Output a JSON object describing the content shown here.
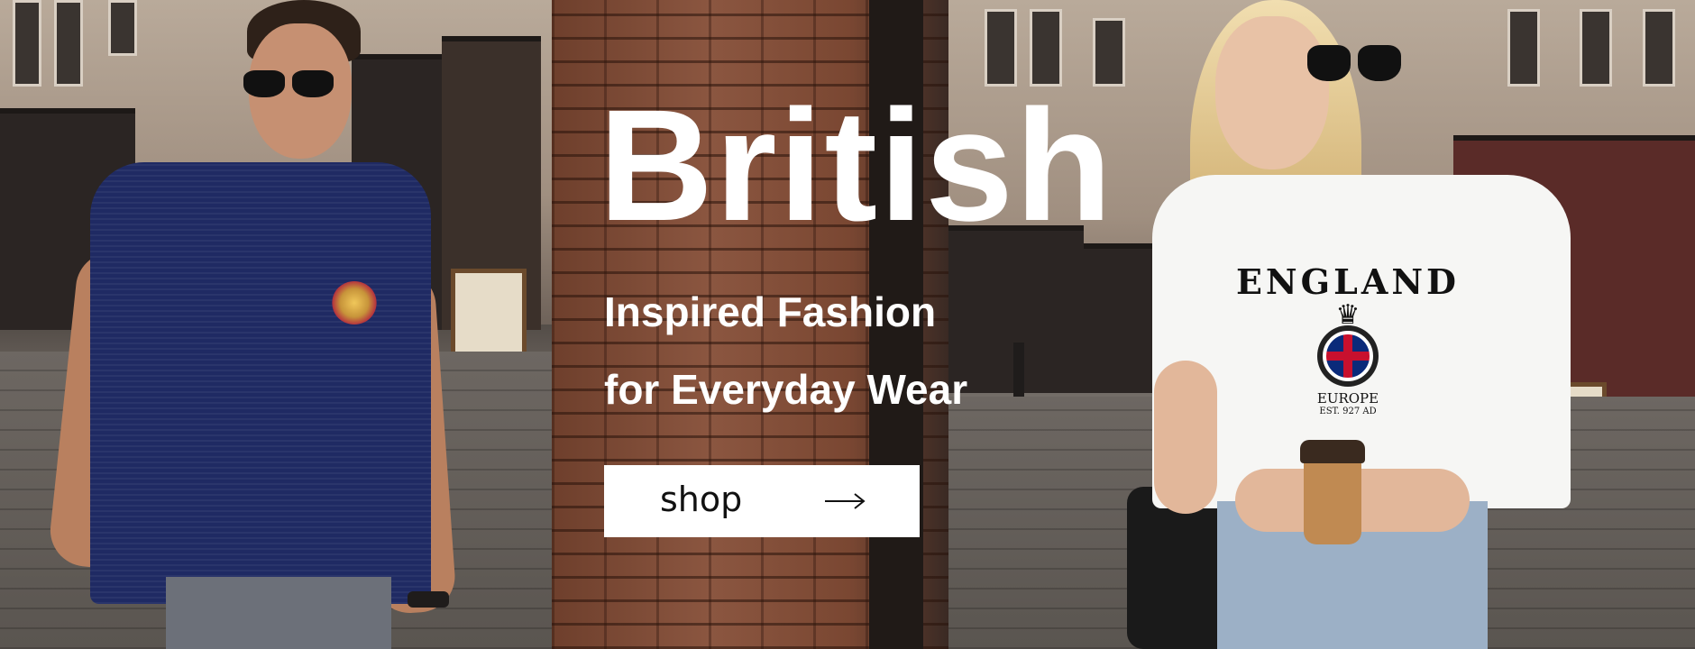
{
  "banner": {
    "headline": "British",
    "subline_1": "Inspired Fashion",
    "subline_2": "for Everyday Wear",
    "cta_label": "shop",
    "cta_icon": "arrow-right-icon"
  },
  "left_model": {
    "description_icon": "man-in-navy-polo",
    "shirt_color": "#1f2a63",
    "pants_color": "#6c7079"
  },
  "right_model": {
    "description_icon": "woman-in-white-tee",
    "tee_print": {
      "line_1": "ENGLAND",
      "line_2": "EUROPE",
      "line_3": "EST. 927 AD"
    },
    "tee_color": "#f6f6f4",
    "jeans_color": "#9cb0c6"
  },
  "colors": {
    "text": "#ffffff",
    "button_bg": "#ffffff",
    "button_text": "#111111",
    "brick": "#7a4a35"
  }
}
